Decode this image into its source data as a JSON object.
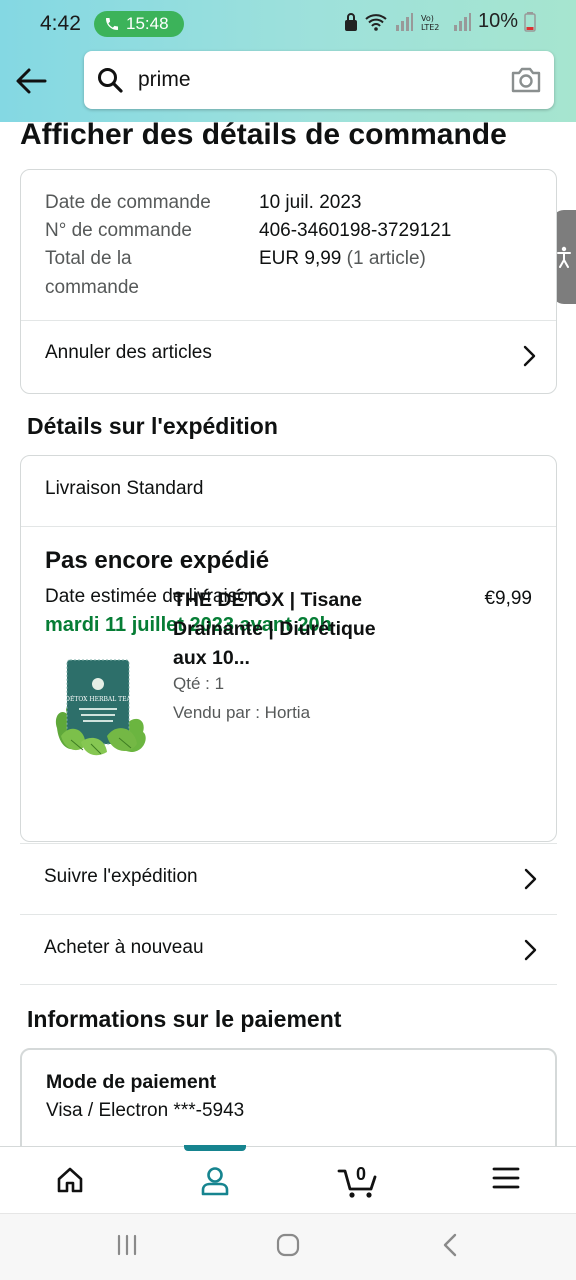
{
  "status_bar": {
    "time": "4:42",
    "call_timer": "15:48",
    "network": "Vo) LTE2",
    "battery": "10%"
  },
  "search": {
    "query": "prime"
  },
  "page": {
    "title": "Afficher des détails de commande"
  },
  "order_summary": {
    "rows": [
      {
        "label": "Date de commande",
        "value": "10 juil. 2023"
      },
      {
        "label": "N° de commande",
        "value": "406-3460198-3729121"
      },
      {
        "label_line1": "Total de la",
        "label_line2": "commande",
        "value": "EUR 9,99",
        "value_suffix": "(1 article)"
      }
    ],
    "cancel_label": "Annuler des articles"
  },
  "shipping": {
    "section_title": "Détails sur l'expédition",
    "method": "Livraison Standard",
    "status": "Pas encore expédié",
    "delivery_label": "Date estimée de livraison :",
    "delivery_date": "mardi 11 juillet 2023 avant 20h",
    "product": {
      "title": "THÉ DÉTOX | Tisane Drainante | Diurétique aux 10...",
      "price": "€9,99",
      "qty": "Qté : 1",
      "seller": "Vendu par : Hortia",
      "image_text": "DÉTOX HERBAL TEA"
    },
    "track_label": "Suivre l'expédition",
    "buy_again_label": "Acheter à nouveau"
  },
  "payment": {
    "section_title": "Informations sur le paiement",
    "method_heading": "Mode de paiement",
    "method_value": "Visa / Electron ***-5943"
  },
  "bottom_nav": {
    "active": "account",
    "cart_count": "0"
  },
  "colors": {
    "header_gradient_start": "#84d8e3",
    "header_gradient_end": "#a6e5cf",
    "delivery_green": "#067d35",
    "active_nav": "#16848f"
  }
}
